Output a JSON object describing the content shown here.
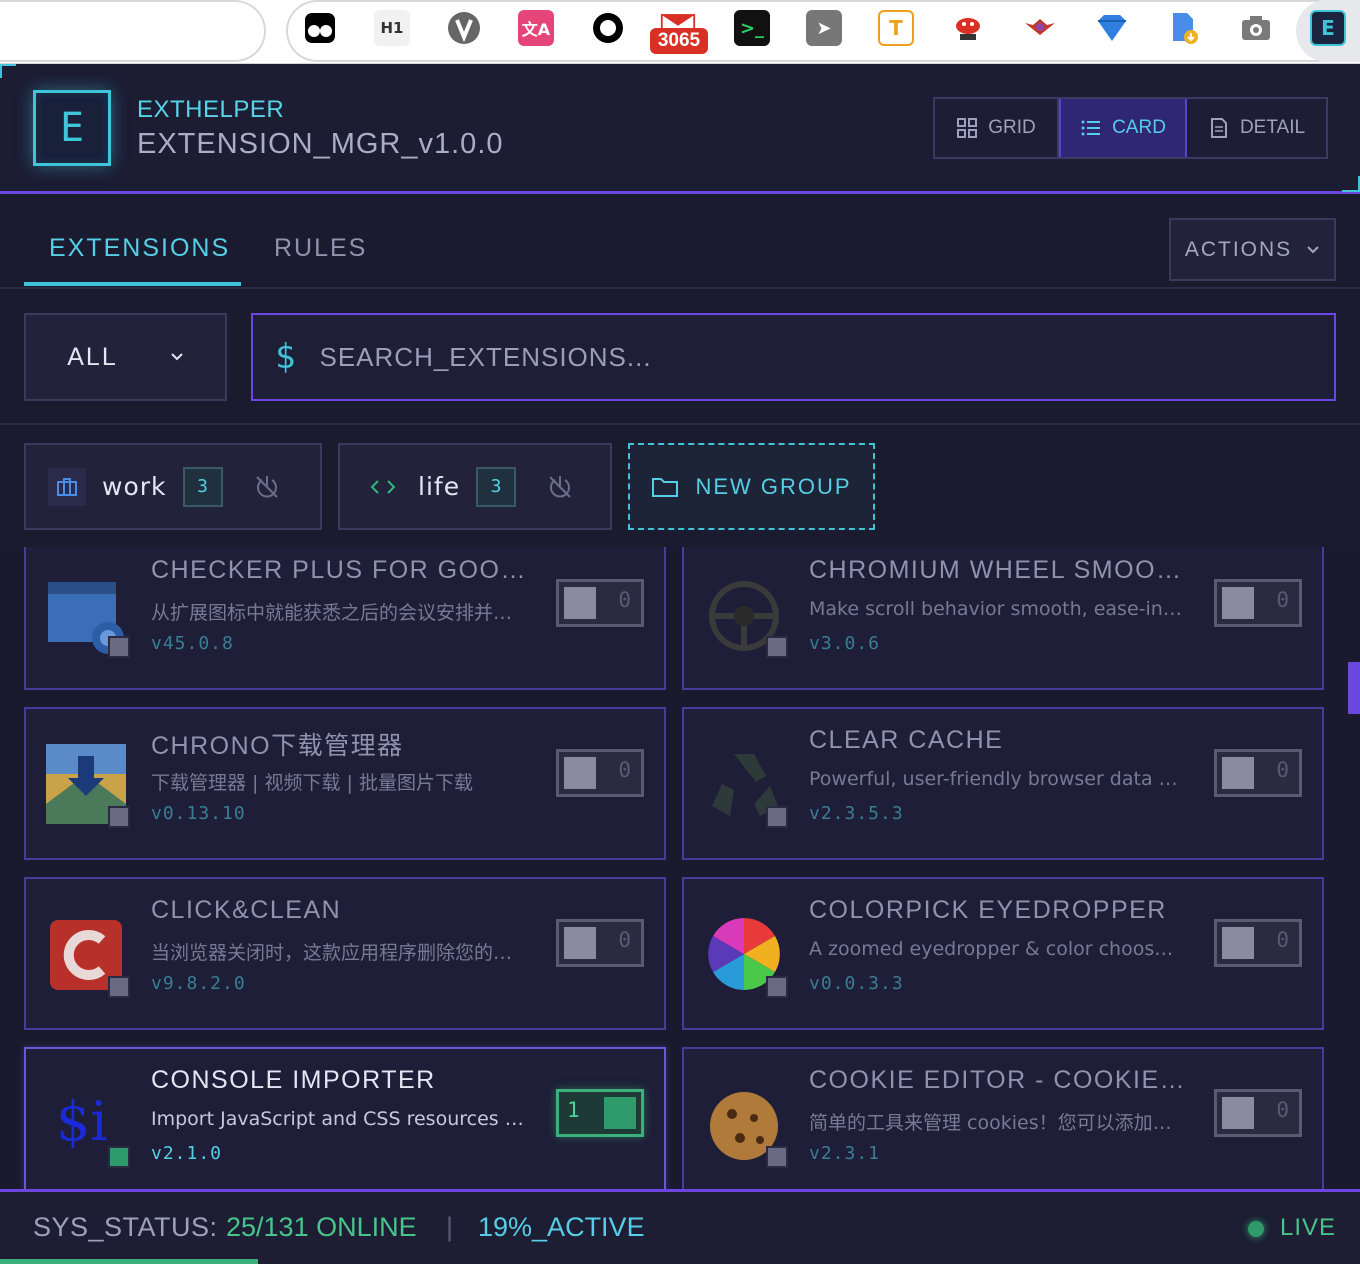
{
  "browser_toolbar": {
    "badge_count": "3065",
    "icons": [
      "tampermonkey-icon",
      "h1-icon",
      "vimium-icon",
      "translate-icon",
      "circle-icon",
      "mail-icon",
      "terminal-icon",
      "cursor-icon",
      "text-icon",
      "crab-icon",
      "bird-icon",
      "diamond-icon",
      "file-download-icon",
      "camera-icon",
      "exthelper-icon"
    ],
    "h1_label": "H1",
    "active_ext_label": "E"
  },
  "header": {
    "logo_letter": "E",
    "brand_name": "EXTHELPER",
    "brand_sub": "EXTENSION_MGR_v1.0.0",
    "views": [
      {
        "label": "GRID",
        "icon": "grid-icon",
        "active": false
      },
      {
        "label": "CARD",
        "icon": "list-icon",
        "active": true
      },
      {
        "label": "DETAIL",
        "icon": "document-icon",
        "active": false
      }
    ]
  },
  "tabs": {
    "extensions": "EXTENSIONS",
    "rules": "RULES",
    "active": "EXTENSIONS"
  },
  "actions_label": "ACTIONS",
  "filter": {
    "selected": "ALL",
    "search_prefix": "$",
    "search_placeholder": "SEARCH_EXTENSIONS...",
    "search_value": ""
  },
  "groups": [
    {
      "name": "work",
      "count": "3",
      "icon": "briefcase-icon"
    },
    {
      "name": "life",
      "count": "3",
      "icon": "code-icon"
    }
  ],
  "new_group_label": "NEW GROUP",
  "extensions": [
    {
      "name": "CHECKER PLUS FOR GOOGLE CALENDAR",
      "desc": "从扩展图标中就能获悉之后的会议安排并且快速添加事件",
      "version": "v45.0.8",
      "enabled": false,
      "toggle_value": "0",
      "icon": "calendar-icon"
    },
    {
      "name": "CHROMIUM WHEEL SMOOTH SCROLLER",
      "desc": "Make scroll behavior smooth, ease-in-out and configurable",
      "version": "v3.0.6",
      "enabled": false,
      "toggle_value": "0",
      "icon": "steering-wheel-icon"
    },
    {
      "name": "CHRONO下载管理器",
      "desc": "下载管理器 | 视频下载 | 批量图片下载",
      "version": "v0.13.10",
      "enabled": false,
      "toggle_value": "0",
      "icon": "download-arrow-icon"
    },
    {
      "name": "CLEAR CACHE",
      "desc": "Powerful, user-friendly browser data cleaner",
      "version": "v2.3.5.3",
      "enabled": false,
      "toggle_value": "0",
      "icon": "recycle-icon"
    },
    {
      "name": "CLICK&CLEAN",
      "desc": "当浏览器关闭时，这款应用程序删除您的历史记录",
      "version": "v9.8.2.0",
      "enabled": false,
      "toggle_value": "0",
      "icon": "c-logo-icon"
    },
    {
      "name": "COLORPICK EYEDROPPER",
      "desc": "A zoomed eyedropper & color chooser tool",
      "version": "v0.0.3.3",
      "enabled": false,
      "toggle_value": "0",
      "icon": "color-wheel-icon"
    },
    {
      "name": "CONSOLE IMPORTER",
      "desc": "Import JavaScript and CSS resources to console",
      "version": "v2.1.0",
      "enabled": true,
      "toggle_value": "1",
      "icon": "dollar-i-icon",
      "icon_text": "$i"
    },
    {
      "name": "COOKIE EDITOR - COOKIE MANAGER",
      "desc": "简单的工具来管理 cookies！您可以添加、删除、编辑",
      "version": "v2.3.1",
      "enabled": false,
      "toggle_value": "0",
      "icon": "cookie-icon"
    }
  ],
  "status": {
    "label": "SYS_STATUS:",
    "online": "25/131 ONLINE",
    "separator": "|",
    "active": "19%_ACTIVE",
    "live": "LIVE",
    "active_fraction": 0.19
  },
  "colors": {
    "accent_cyan": "#3ec5d8",
    "accent_purple": "#6b46e0",
    "online_green": "#48c58a",
    "badge_red": "#d93025"
  }
}
